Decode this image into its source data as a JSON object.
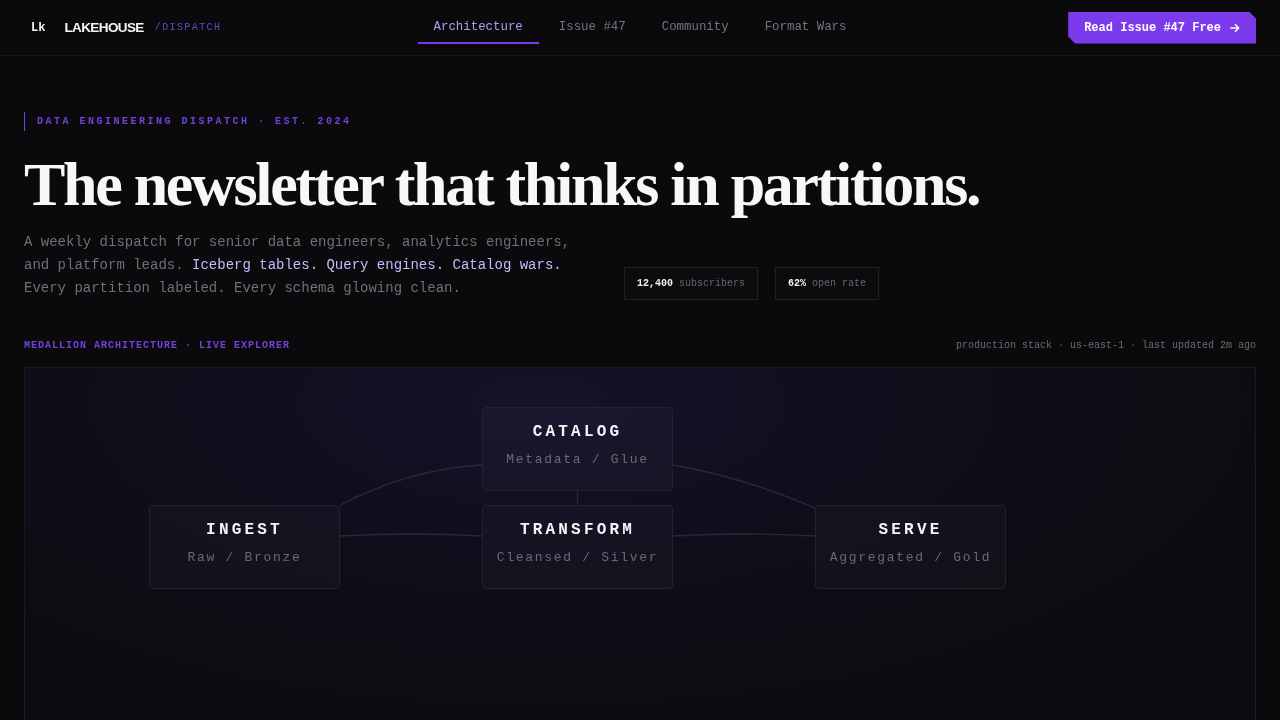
{
  "nav": {
    "logo_mark": "Lk",
    "brand": "LAKEHOUSE",
    "brand_suffix": "/DISPATCH",
    "tabs": [
      {
        "label": "Architecture",
        "selected": true
      },
      {
        "label": "Issue #47",
        "selected": false
      },
      {
        "label": "Community",
        "selected": false
      },
      {
        "label": "Format Wars",
        "selected": false
      }
    ],
    "cta": {
      "label": "Read Issue #47 Free"
    }
  },
  "hero": {
    "eyebrow": "DATA ENGINEERING DISPATCH · EST. 2024",
    "headline": "The newsletter that thinks in partitions.",
    "lead": [
      {
        "text": "A weekly dispatch for senior data engineers, analytics engineers, and platform leads. ",
        "highlight": false
      },
      {
        "text": "Iceberg tables. Query engines. Catalog wars.",
        "highlight": true
      },
      {
        "text": " Every partition labeled. Every schema glowing clean.",
        "highlight": false
      }
    ],
    "stats": [
      {
        "value": "12,400",
        "label": "subscribers"
      },
      {
        "value": "62%",
        "label": "open rate"
      }
    ]
  },
  "explorer": {
    "title": "MEDALLION ARCHITECTURE · LIVE EXPLORER",
    "meta": "production stack · us-east-1 · last updated 2m ago",
    "nodes": [
      {
        "title": "CATALOG",
        "subtitle": "Metadata / Glue"
      },
      {
        "title": "INGEST",
        "subtitle": "Raw / Bronze"
      },
      {
        "title": "TRANSFORM",
        "subtitle": "Cleansed / Silver"
      },
      {
        "title": "SERVE",
        "subtitle": "Aggregated / Gold"
      }
    ]
  }
}
